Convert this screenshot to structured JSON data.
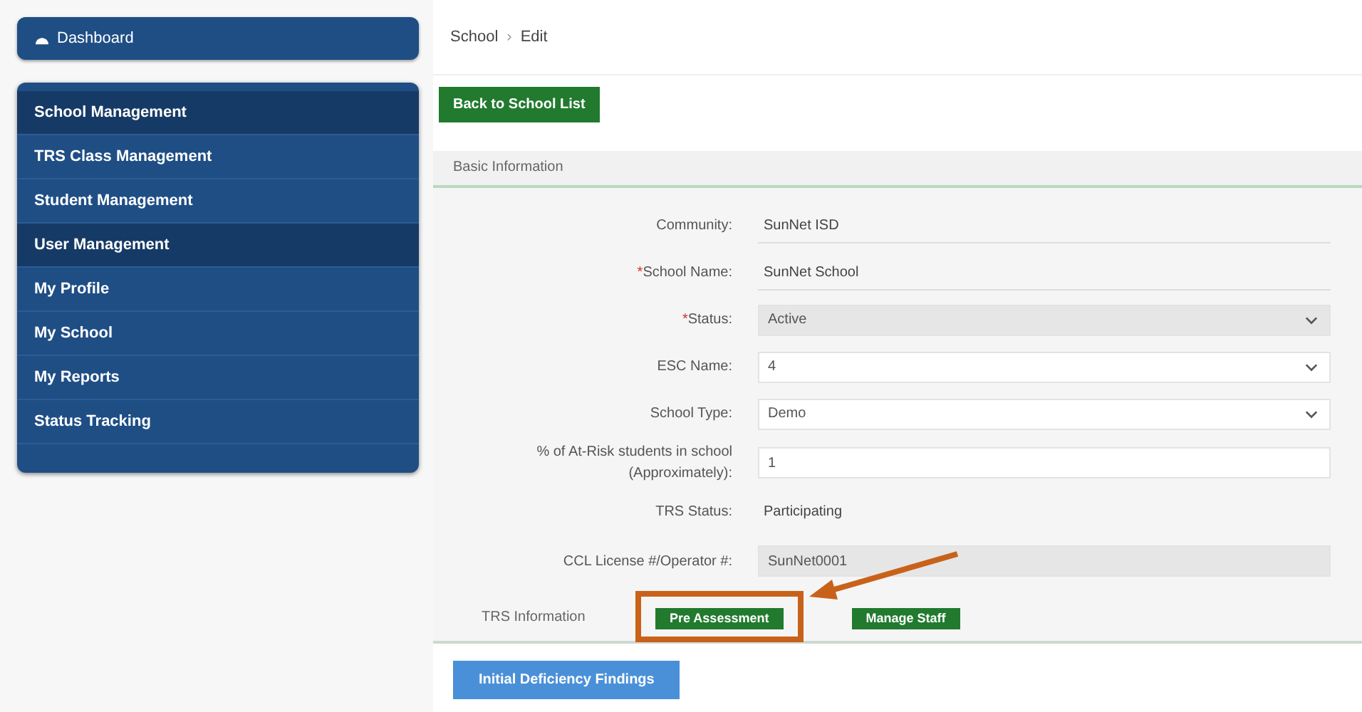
{
  "sidebar": {
    "dashboard": {
      "label": "Dashboard"
    },
    "items": [
      {
        "label": "School Management",
        "selected": true
      },
      {
        "label": "TRS Class Management",
        "selected": false
      },
      {
        "label": "Student Management",
        "selected": false
      },
      {
        "label": "User Management",
        "selected": true
      },
      {
        "label": "My Profile",
        "selected": false
      },
      {
        "label": "My School",
        "selected": false
      },
      {
        "label": "My Reports",
        "selected": false
      },
      {
        "label": "Status Tracking",
        "selected": false
      }
    ]
  },
  "breadcrumb": {
    "parent": "School",
    "separator": "›",
    "current": "Edit"
  },
  "back_button": "Back to School List",
  "panel": {
    "title": "Basic Information",
    "fields": [
      {
        "label": "Community:",
        "kind": "text",
        "value": "SunNet ISD"
      },
      {
        "label": "School Name:",
        "mark": "*",
        "kind": "text",
        "value": "SunNet School"
      },
      {
        "label": "Status:",
        "mark": "*",
        "kind": "select",
        "value": "Active",
        "disabled": true
      },
      {
        "label": "ESC Name:",
        "kind": "select",
        "value": "4",
        "disabled": false
      },
      {
        "label": "School Type:",
        "kind": "select",
        "value": "Demo",
        "disabled": false
      },
      {
        "label": "% of At-Risk students in school (Approximately):",
        "kind": "input",
        "value": "1",
        "disabled": false
      },
      {
        "label": "TRS Status:",
        "kind": "plain",
        "value": "Participating"
      },
      {
        "label": "CCL License #/Operator #:",
        "kind": "input",
        "value": "SunNet0001",
        "disabled": true
      }
    ]
  },
  "trs": {
    "label": "TRS Information",
    "buttons": [
      {
        "label": "Pre Assessment",
        "highlighted": true
      },
      {
        "label": "Manage Staff",
        "highlighted": false
      }
    ]
  },
  "findings_button": "Initial Deficiency Findings"
}
